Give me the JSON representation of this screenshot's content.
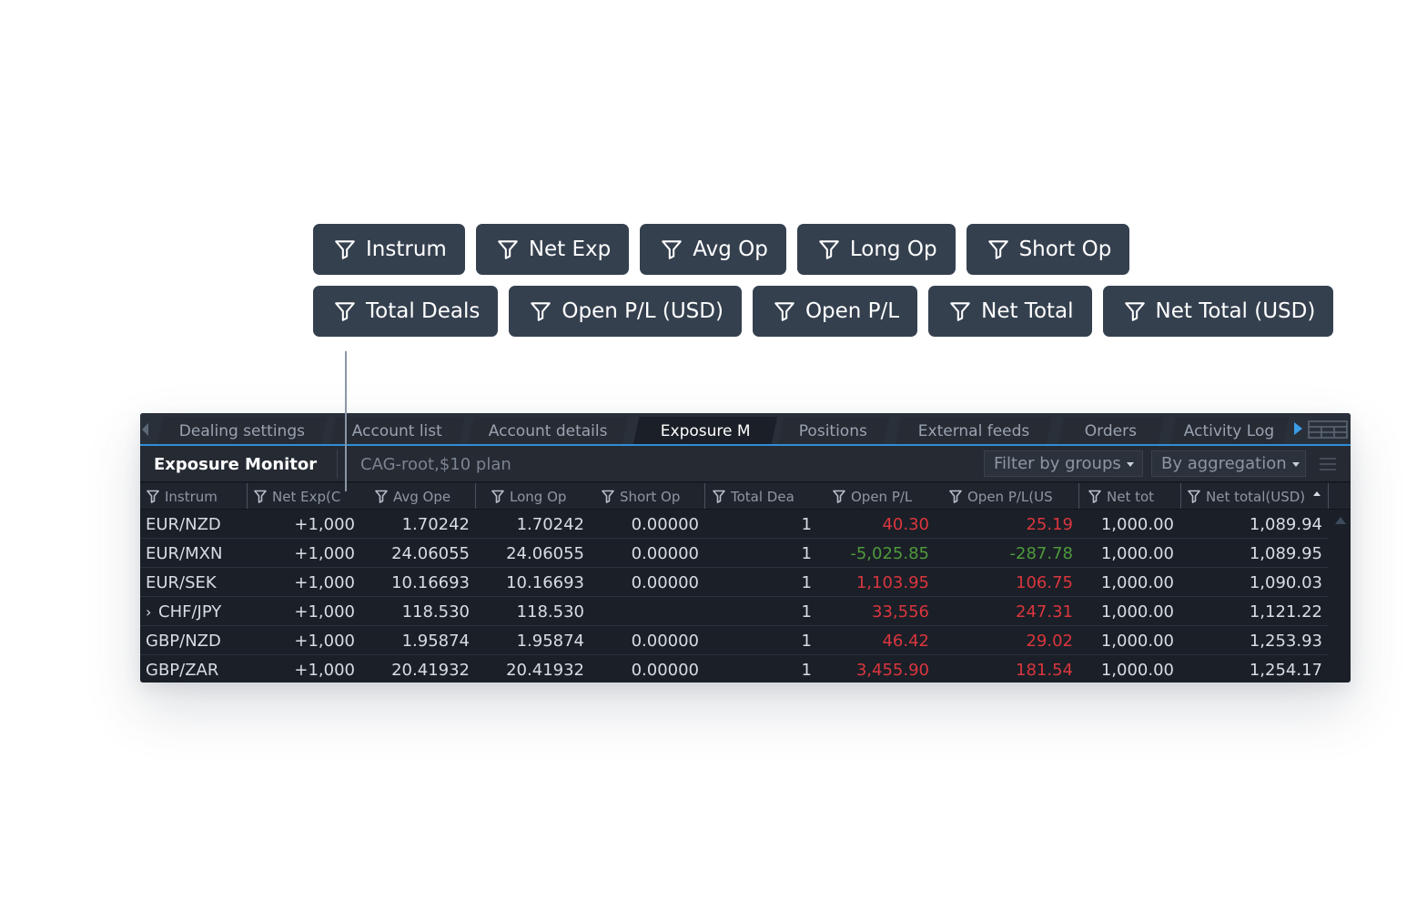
{
  "chips_row1": [
    {
      "label": "Instrum"
    },
    {
      "label": "Net Exp"
    },
    {
      "label": "Avg Op"
    },
    {
      "label": "Long Op"
    },
    {
      "label": "Short Op"
    }
  ],
  "chips_row2": [
    {
      "label": "Total Deals"
    },
    {
      "label": "Open P/L (USD)"
    },
    {
      "label": "Open P/L"
    },
    {
      "label": "Net Total"
    },
    {
      "label": "Net Total (USD)"
    }
  ],
  "tabs": [
    {
      "label": "Dealing settings",
      "active": false
    },
    {
      "label": "Account list",
      "active": false
    },
    {
      "label": "Account details",
      "active": false
    },
    {
      "label": "Exposure M",
      "active": true
    },
    {
      "label": "Positions",
      "active": false
    },
    {
      "label": "External feeds",
      "active": false
    },
    {
      "label": "Orders",
      "active": false
    },
    {
      "label": "Activity Log",
      "active": false
    }
  ],
  "toolbar": {
    "title": "Exposure Monitor",
    "account_path": "CAG-root,$10 plan",
    "filter_dropdown": "Filter by groups",
    "aggregation_dropdown": "By aggregation"
  },
  "columns": [
    "Instrum",
    "Net Exp(C",
    "Avg Ope",
    "Long Op",
    "Short Op",
    "Total Dea",
    "Open P/L",
    "Open P/L(US",
    "Net tot",
    "Net total(USD)"
  ],
  "rows": [
    {
      "instrument": "EUR/NZD",
      "expandable": false,
      "net_exp": "+1,000",
      "avg_open": "1.70242",
      "long_open": "1.70242",
      "short_open": "0.00000",
      "total_deals": "1",
      "open_pl": "40.30",
      "open_pl_sign": "neg",
      "open_pl_usd": "25.19",
      "open_pl_usd_sign": "neg",
      "net_total": "1,000.00",
      "net_total_usd": "1,089.94"
    },
    {
      "instrument": "EUR/MXN",
      "expandable": false,
      "net_exp": "+1,000",
      "avg_open": "24.06055",
      "long_open": "24.06055",
      "short_open": "0.00000",
      "total_deals": "1",
      "open_pl": "-5,025.85",
      "open_pl_sign": "pos",
      "open_pl_usd": "-287.78",
      "open_pl_usd_sign": "pos",
      "net_total": "1,000.00",
      "net_total_usd": "1,089.95"
    },
    {
      "instrument": "EUR/SEK",
      "expandable": false,
      "net_exp": "+1,000",
      "avg_open": "10.16693",
      "long_open": "10.16693",
      "short_open": "0.00000",
      "total_deals": "1",
      "open_pl": "1,103.95",
      "open_pl_sign": "neg",
      "open_pl_usd": "106.75",
      "open_pl_usd_sign": "neg",
      "net_total": "1,000.00",
      "net_total_usd": "1,090.03"
    },
    {
      "instrument": "CHF/JPY",
      "expandable": true,
      "net_exp": "+1,000",
      "avg_open": "118.530",
      "long_open": "118.530",
      "short_open": "",
      "total_deals": "1",
      "open_pl": "33,556",
      "open_pl_sign": "neg",
      "open_pl_usd": "247.31",
      "open_pl_usd_sign": "neg",
      "net_total": "1,000.00",
      "net_total_usd": "1,121.22"
    },
    {
      "instrument": "GBP/NZD",
      "expandable": false,
      "net_exp": "+1,000",
      "avg_open": "1.95874",
      "long_open": "1.95874",
      "short_open": "0.00000",
      "total_deals": "1",
      "open_pl": "46.42",
      "open_pl_sign": "neg",
      "open_pl_usd": "29.02",
      "open_pl_usd_sign": "neg",
      "net_total": "1,000.00",
      "net_total_usd": "1,253.93"
    },
    {
      "instrument": "GBP/ZAR",
      "expandable": false,
      "net_exp": "+1,000",
      "avg_open": "20.41932",
      "long_open": "20.41932",
      "short_open": "0.00000",
      "total_deals": "1",
      "open_pl": "3,455.90",
      "open_pl_sign": "neg",
      "open_pl_usd": "181.54",
      "open_pl_usd_sign": "neg",
      "net_total": "1,000.00",
      "net_total_usd": "1,254.17"
    }
  ],
  "icons": {
    "chip": "filter-icon",
    "column": "filter-icon",
    "sort": "sort-ascending-icon",
    "menu": "menu-icon",
    "layout": "layout-grid-icon"
  },
  "colors": {
    "chip_bg": "#35404f",
    "panel_bg": "#1b1f27",
    "negative": "#d9363e",
    "positive": "#4e9a3c",
    "accent": "#2d8fd8"
  }
}
